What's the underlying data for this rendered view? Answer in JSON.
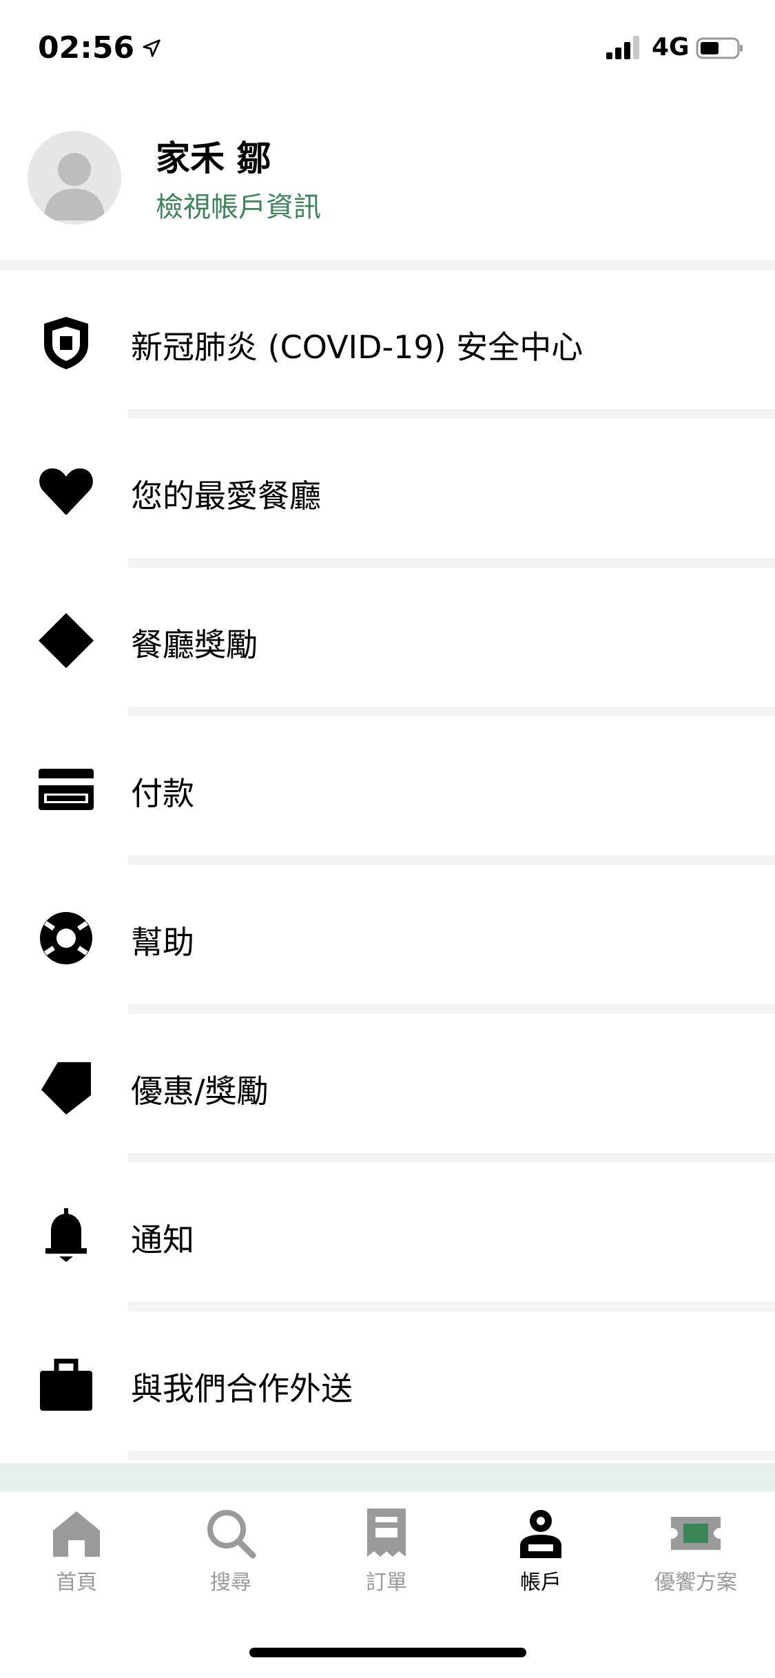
{
  "status_bar": {
    "time": "02:56",
    "network": "4G"
  },
  "profile": {
    "name": "家禾 鄒",
    "link": "檢視帳戶資訊"
  },
  "menu": [
    {
      "label": "新冠肺炎 (COVID-19) 安全中心",
      "icon": "shield-icon"
    },
    {
      "label": "您的最愛餐廳",
      "icon": "heart-icon"
    },
    {
      "label": "餐廳獎勵",
      "icon": "diamond-icon"
    },
    {
      "label": "付款",
      "icon": "credit-card-icon"
    },
    {
      "label": "幫助",
      "icon": "lifebuoy-icon"
    },
    {
      "label": "優惠/獎勵",
      "icon": "tag-icon"
    },
    {
      "label": "通知",
      "icon": "bell-icon"
    },
    {
      "label": "與我們合作外送",
      "icon": "briefcase-icon"
    }
  ],
  "tabs": [
    {
      "label": "首頁",
      "icon": "home-icon",
      "active": false
    },
    {
      "label": "搜尋",
      "icon": "search-icon",
      "active": false
    },
    {
      "label": "訂單",
      "icon": "receipt-icon",
      "active": false
    },
    {
      "label": "帳戶",
      "icon": "person-icon",
      "active": true
    },
    {
      "label": "優饗方案",
      "icon": "ticket-icon",
      "active": false
    }
  ],
  "colors": {
    "accent_green": "#3a8556",
    "inactive_gray": "#9a9a9a",
    "band_green": "#e5f1ea"
  }
}
